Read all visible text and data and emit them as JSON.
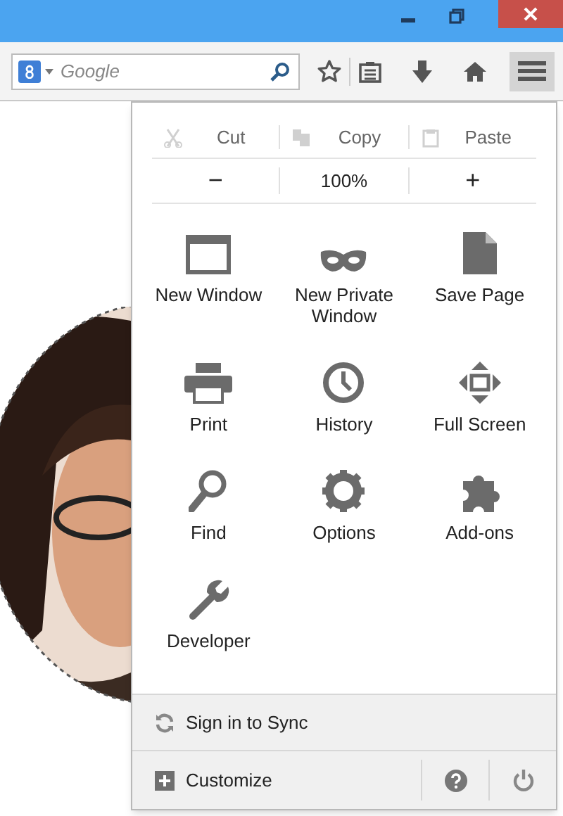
{
  "search": {
    "placeholder": "Google"
  },
  "menu_button": {
    "pressed": true
  },
  "edit_row": [
    {
      "label": "Cut",
      "disabled": true
    },
    {
      "label": "Copy",
      "disabled": true
    },
    {
      "label": "Paste",
      "disabled": true
    }
  ],
  "zoom_row": {
    "decrease": "−",
    "level": "100%",
    "increase": "+"
  },
  "items": [
    {
      "label": "New Window"
    },
    {
      "label": "New Private Window"
    },
    {
      "label": "Save Page"
    },
    {
      "label": "Print"
    },
    {
      "label": "History"
    },
    {
      "label": "Full Screen"
    },
    {
      "label": "Find"
    },
    {
      "label": "Options"
    },
    {
      "label": "Add-ons"
    },
    {
      "label": "Developer"
    }
  ],
  "sync": {
    "label": "Sign in to Sync"
  },
  "footer": {
    "customize": "Customize"
  }
}
